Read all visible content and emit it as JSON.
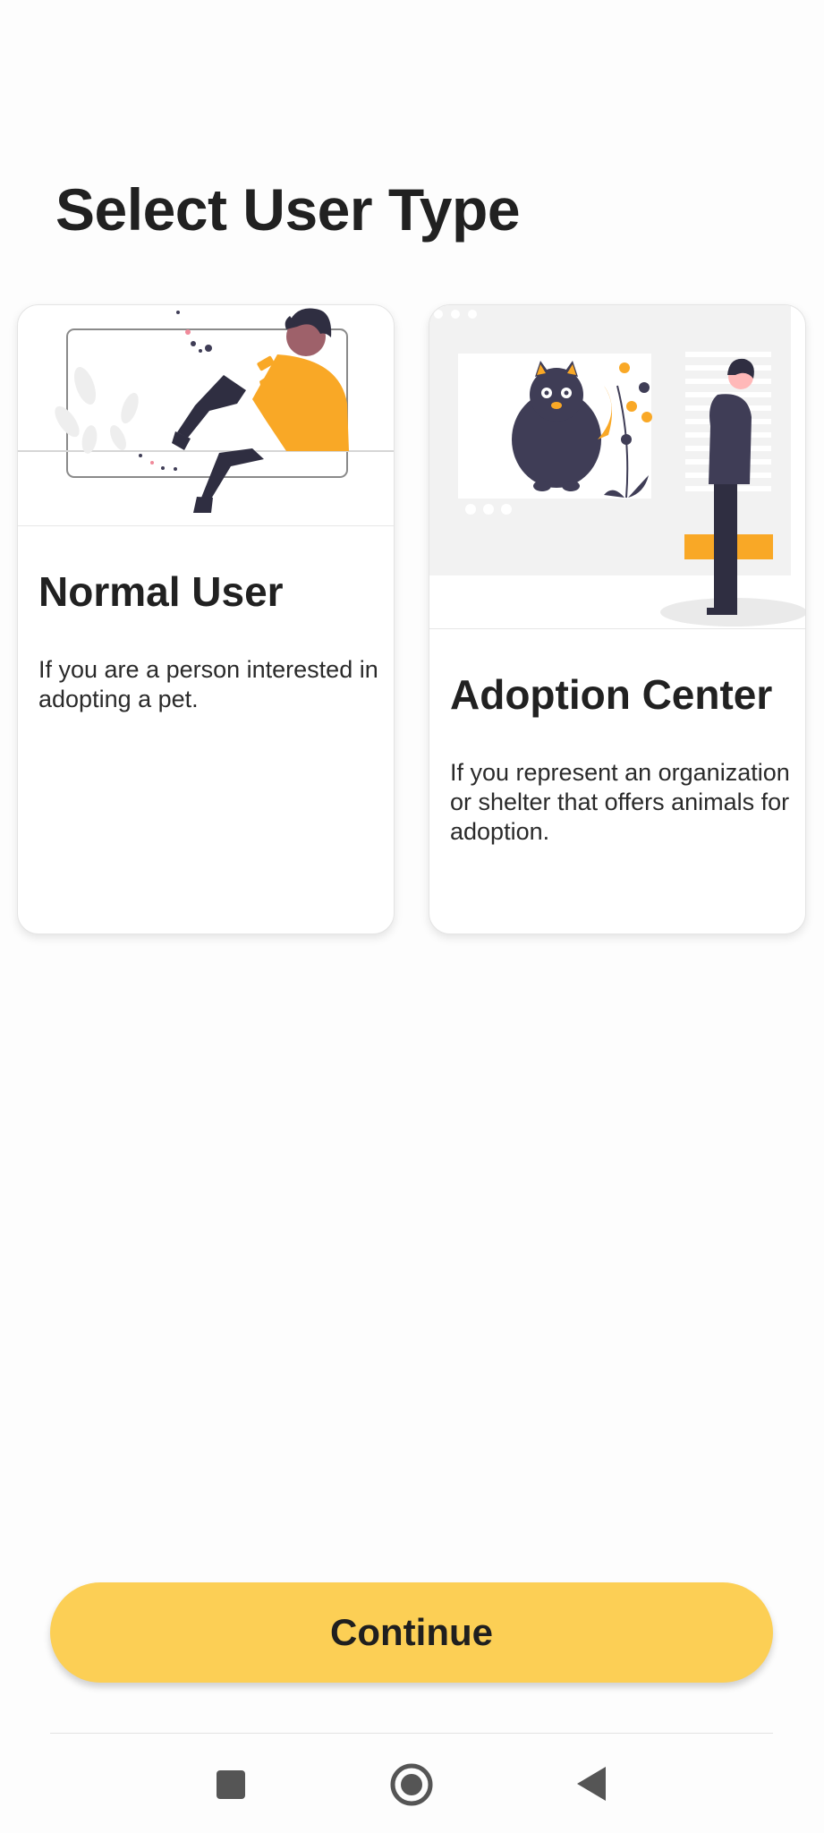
{
  "page": {
    "title": "Select User Type"
  },
  "user_types": [
    {
      "title": "Normal User",
      "description": "If you are a person interested in adopting a pet."
    },
    {
      "title": "Adoption Center",
      "description": "If you represent an organization or shelter that offers animals for adoption."
    }
  ],
  "actions": {
    "continue_label": "Continue"
  },
  "navigation_bar": {
    "buttons": [
      {
        "icon": "square-recent-apps-icon"
      },
      {
        "icon": "circle-home-icon"
      },
      {
        "icon": "triangle-back-icon"
      }
    ]
  },
  "colors": {
    "accent": "#fccf55",
    "illustration_yellow": "#f9a826",
    "illustration_dark": "#3f3d56",
    "text": "#212121"
  }
}
